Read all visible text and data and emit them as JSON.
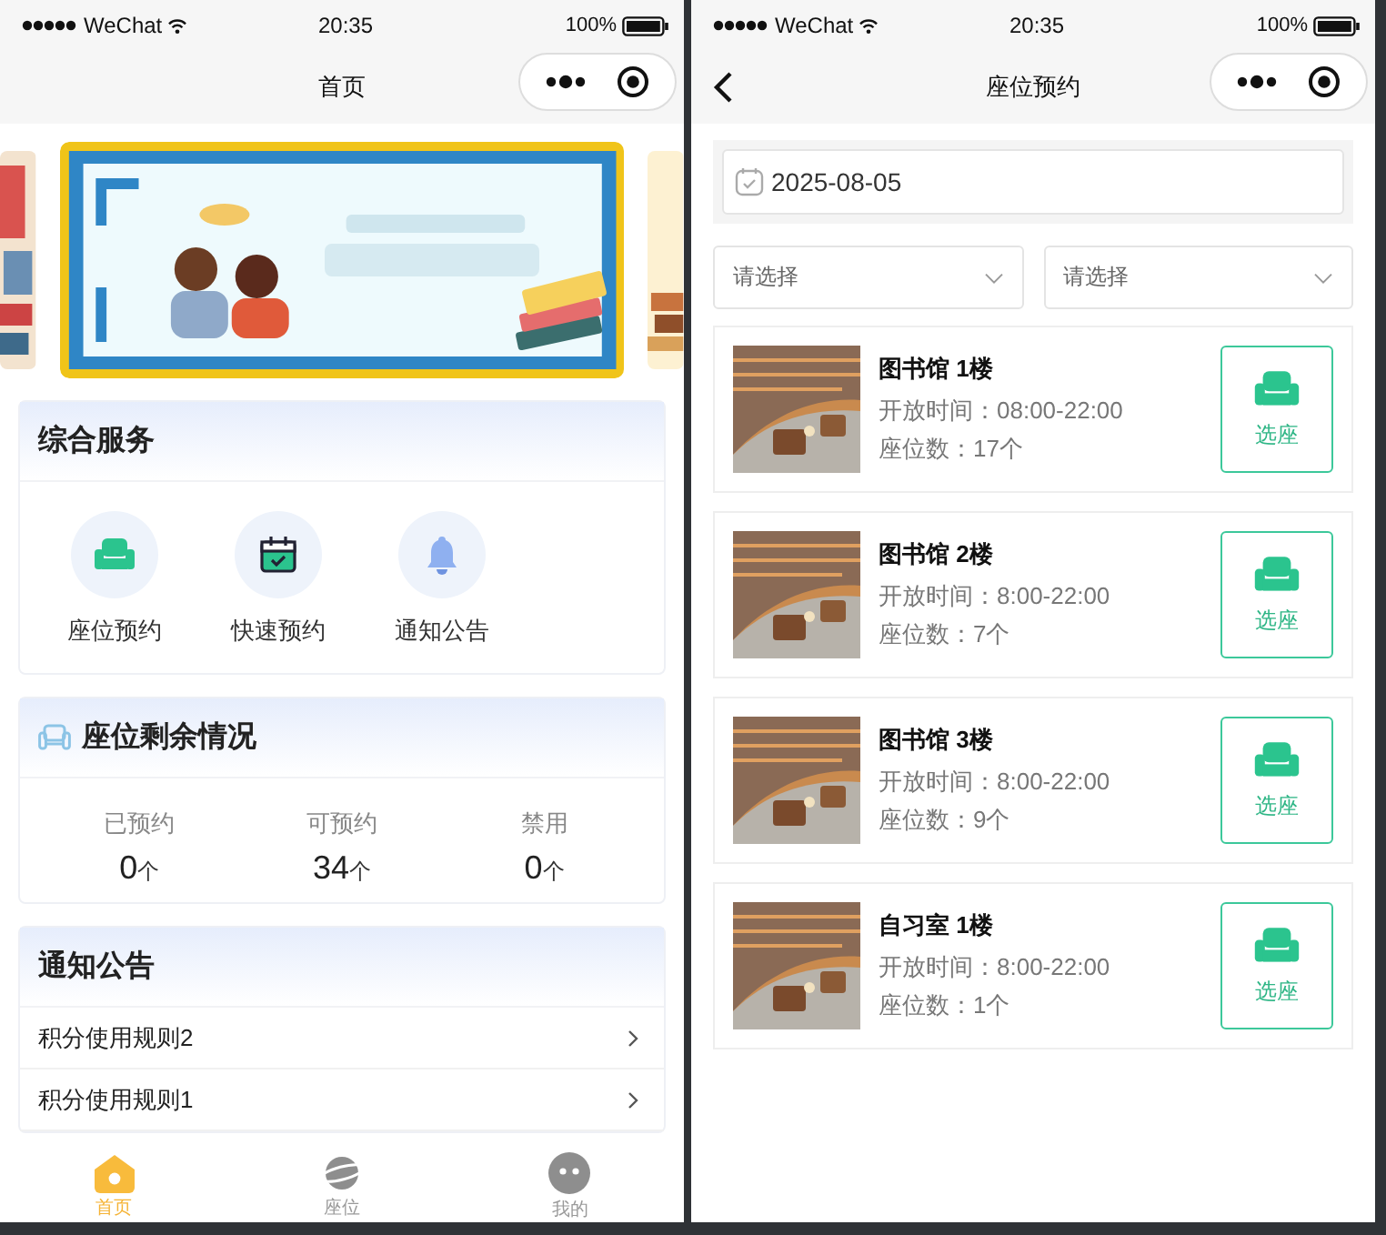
{
  "home": {
    "status_bar": {
      "carrier": "WeChat",
      "time": "20:35",
      "battery": "100%"
    },
    "title": "首页",
    "services": {
      "title": "综合服务",
      "items": [
        {
          "label": "座位预约",
          "kind": "sofa"
        },
        {
          "label": "快速预约",
          "kind": "calendar"
        },
        {
          "label": "通知公告",
          "kind": "bell"
        }
      ]
    },
    "seats": {
      "title": "座位剩余情况",
      "stats": [
        {
          "label": "已预约",
          "value": "0",
          "unit": "个"
        },
        {
          "label": "可预约",
          "value": "34",
          "unit": "个"
        },
        {
          "label": "禁用",
          "value": "0",
          "unit": "个"
        }
      ]
    },
    "notices": {
      "title": "通知公告",
      "items": [
        "积分使用规则2",
        "积分使用规则1"
      ]
    },
    "tabbar": [
      {
        "label": "首页",
        "kind": "home",
        "selected": true
      },
      {
        "label": "座位",
        "kind": "planet",
        "selected": false
      },
      {
        "label": "我的",
        "kind": "face",
        "selected": false
      }
    ]
  },
  "booking": {
    "status_bar": {
      "carrier": "WeChat",
      "time": "20:35",
      "battery": "100%"
    },
    "title": "座位预约",
    "date": "2025-08-05",
    "selects": [
      {
        "placeholder": "请选择"
      },
      {
        "placeholder": "请选择"
      }
    ],
    "rooms": [
      {
        "name": "图书馆 1楼",
        "hours": "开放时间：08:00-22:00",
        "seats": "座位数：17个",
        "button": "选座"
      },
      {
        "name": "图书馆 2楼",
        "hours": "开放时间：8:00-22:00",
        "seats": "座位数：7个",
        "button": "选座"
      },
      {
        "name": "图书馆 3楼",
        "hours": "开放时间：8:00-22:00",
        "seats": "座位数：9个",
        "button": "选座"
      },
      {
        "name": "自习室 1楼",
        "hours": "开放时间：8:00-22:00",
        "seats": "座位数：1个",
        "button": "选座"
      }
    ]
  }
}
